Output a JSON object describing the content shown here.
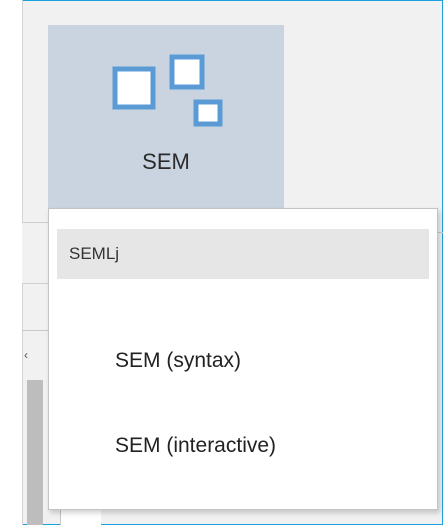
{
  "ribbon": {
    "sem_button_label": "SEM",
    "sem_icon": "sem-diagram-icon",
    "button_bg_color": "#c9d4e0",
    "icon_color": "#5b9bd5"
  },
  "menu": {
    "group_header": "SEMLj",
    "items": [
      {
        "label": "SEM (syntax)"
      },
      {
        "label": "SEM (interactive)"
      }
    ]
  },
  "window": {
    "border_color": "#1ba1e2"
  }
}
